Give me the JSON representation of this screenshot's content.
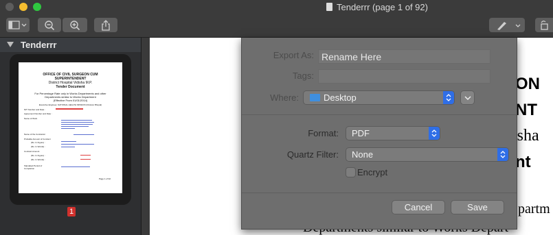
{
  "window": {
    "title": "Tenderrr (page 1 of 92)"
  },
  "sidebar": {
    "title": "Tenderrr",
    "page_badge": "1"
  },
  "thumbnail": {
    "line1": "OFFICE OF CIVIL SURGEON CUM",
    "line2": "SUPERINTENDENT",
    "line3": "District Hospital Vidisha M.P.",
    "line4": "Tender Document",
    "line5": "For Percentage Rate only in Works Departments and other",
    "line6": "Departments similar to Works Department",
    "line7": "(Effective From 01/01/2014)",
    "line8": "Executive Engineer, NATIONAL HEALTH MISSION (Division Bhopal)",
    "field1": "NIT Number and Date :",
    "field2": "Agreement Number and Date :",
    "field3": "Name of Work",
    "field4": "Name of the Contractor",
    "field5": "Probable Amount of Contract",
    "field6": "(Rs. In Figure) :",
    "field7": "(Rs. In Words) :",
    "field8": "Contract Amount",
    "field9": "(Rs. In Figure) :",
    "field10": "(Rs. In Words) :",
    "field11": "Stipulated Period of",
    "field12": "Completion",
    "footer": "Page 1 of 92"
  },
  "document": {
    "frag1": "EON",
    "frag2": "ENT",
    "frag3": "isha",
    "frag4": "nt",
    "frag5": "partm",
    "frag6": "Departments similar to Works Depart"
  },
  "dialog": {
    "export_as_label": "Export As:",
    "export_as_value": "Rename Here",
    "tags_label": "Tags:",
    "tags_value": "",
    "where_label": "Where:",
    "where_value": "Desktop",
    "format_label": "Format:",
    "format_value": "PDF",
    "quartz_label": "Quartz Filter:",
    "quartz_value": "None",
    "encrypt_label": "Encrypt",
    "cancel_label": "Cancel",
    "save_label": "Save"
  },
  "colors": {
    "accent": "#2f6ee6",
    "folder": "#3f8fdf",
    "page_badge": "#d0312d"
  },
  "icons": [
    "sidebar-toggle-icon",
    "chevron-down-icon",
    "zoom-out-icon",
    "zoom-in-icon",
    "share-icon",
    "markup-pen-icon",
    "rotate-icon",
    "folder-icon",
    "document-icon"
  ]
}
